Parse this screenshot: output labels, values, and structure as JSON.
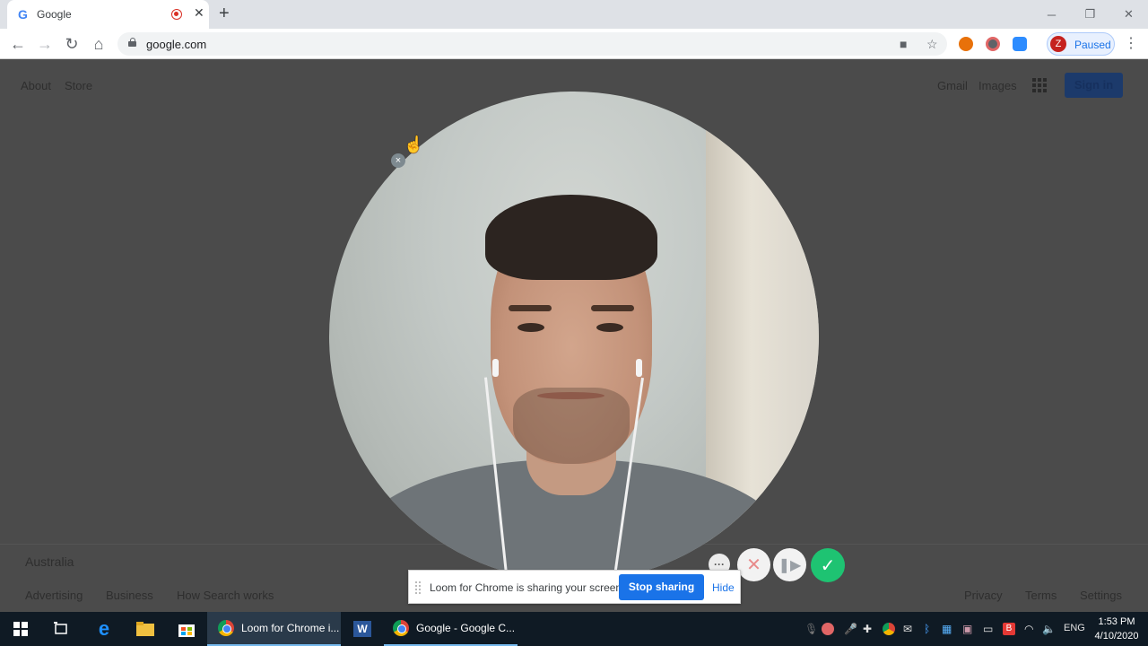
{
  "browser": {
    "tab_title": "Google",
    "tab_favicon": "G",
    "new_tab": "+",
    "url": "google.com",
    "profile_initial": "Z",
    "profile_label": "Paused"
  },
  "google": {
    "top_left": [
      "About",
      "Store"
    ],
    "top_right": [
      "Gmail",
      "Images"
    ],
    "signin_label": "Sign in",
    "country": "Australia",
    "footer_left": [
      "Advertising",
      "Business",
      "How Search works"
    ],
    "footer_right": [
      "Privacy",
      "Terms",
      "Settings"
    ]
  },
  "loom": {
    "share_message": "Loom for Chrome is sharing your screen.",
    "stop_label": "Stop sharing",
    "hide_label": "Hide",
    "more_label": "···",
    "close_label": "×"
  },
  "taskbar": {
    "apps": [
      {
        "label": "Loom for Chrome i..."
      },
      {
        "label": "Google - Google C..."
      }
    ],
    "language": "ENG",
    "time": "1:53 PM",
    "date": "4/10/2020",
    "word_icon_letter": "W"
  },
  "colors": {
    "loom_done": "#1ec372",
    "stop_button": "#1a73e8",
    "taskbar": "#0f1a24"
  }
}
